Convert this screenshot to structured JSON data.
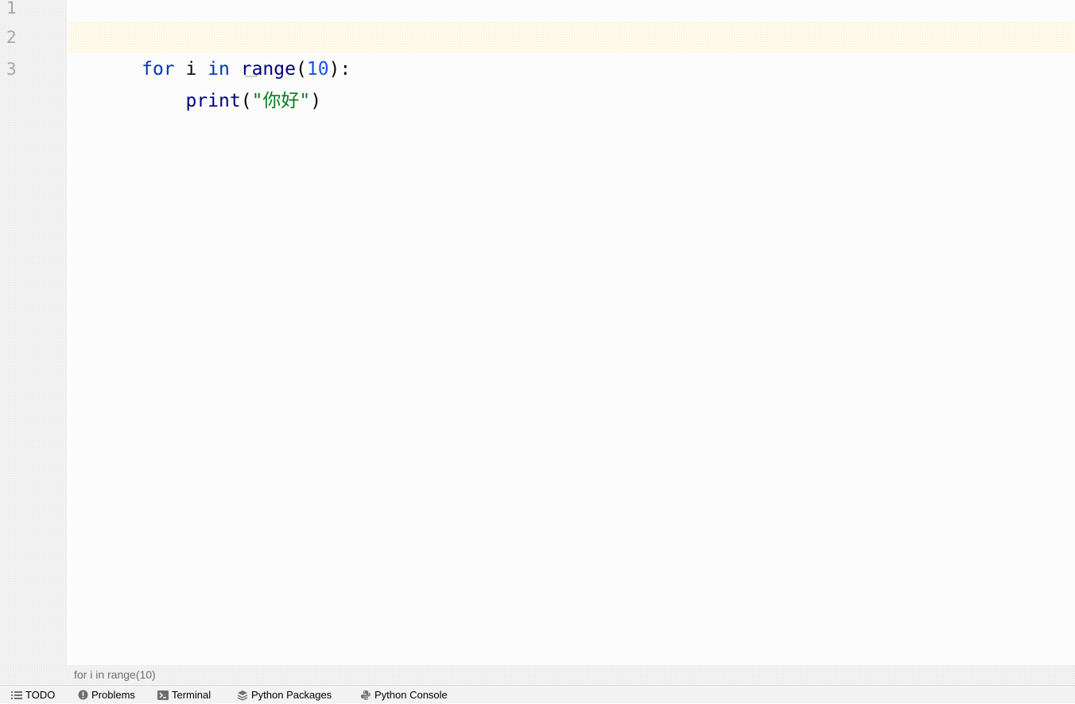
{
  "editor": {
    "line_numbers": [
      "1",
      "2",
      "3"
    ],
    "lines": [
      {
        "tokens": []
      },
      {
        "tokens": [
          {
            "text": "for",
            "kind": "kw"
          },
          {
            "text": " i ",
            "kind": "plain"
          },
          {
            "text": "in",
            "kind": "kw"
          },
          {
            "text": " range",
            "kind": "fn"
          },
          {
            "text": "(",
            "kind": "plain"
          },
          {
            "text": "10",
            "kind": "num"
          },
          {
            "text": "):",
            "kind": "plain"
          }
        ]
      },
      {
        "tokens": [
          {
            "text": "    print",
            "kind": "fn"
          },
          {
            "text": "(",
            "kind": "plain"
          },
          {
            "text": "\"你好\"",
            "kind": "str"
          },
          {
            "text": ")",
            "kind": "plain"
          }
        ]
      }
    ],
    "current_line": 2
  },
  "breadcrumb": {
    "text": "for i in range(10)"
  },
  "toolwindows": {
    "todo": "TODO",
    "problems": "Problems",
    "terminal": "Terminal",
    "python_packages": "Python Packages",
    "python_console": "Python Console"
  },
  "colors": {
    "keyword": "#0033b3",
    "number": "#1750eb",
    "string": "#067d17",
    "function": "#000080",
    "current_line_bg": "#fefbeb"
  }
}
